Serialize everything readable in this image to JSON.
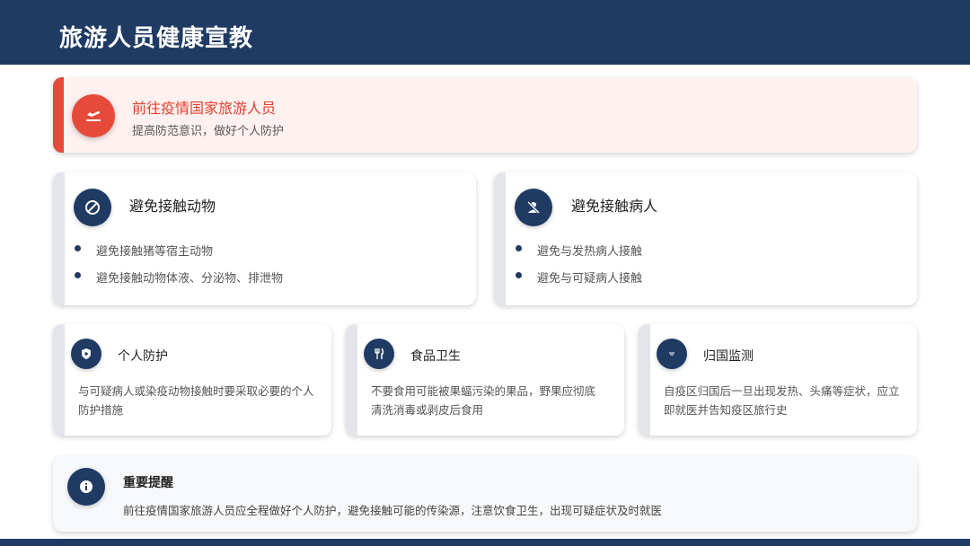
{
  "header": {
    "title": "旅游人员健康宣教"
  },
  "banner": {
    "icon": "airplane-departure-icon",
    "title": "前往疫情国家旅游人员",
    "subtitle": "提高防范意识，做好个人防护"
  },
  "cards_top": [
    {
      "icon": "prohibited-icon",
      "title": "避免接触动物",
      "items": [
        "避免接触猪等宿主动物",
        "避免接触动物体液、分泌物、排泄物"
      ]
    },
    {
      "icon": "no-person-icon",
      "title": "避免接触病人",
      "items": [
        "避免与发热病人接触",
        "避免与可疑病人接触"
      ]
    }
  ],
  "cards_mid": [
    {
      "icon": "shield-icon",
      "title": "个人防护",
      "text": "与可疑病人或染疫动物接触时要采取必要的个人防护措施"
    },
    {
      "icon": "utensils-icon",
      "title": "食品卫生",
      "text": "不要食用可能被果蝠污染的果品，野果应彻底清洗消毒或剥皮后食用"
    },
    {
      "icon": "thermometer-icon",
      "title": "归国监测",
      "text": "自疫区归国后一旦出现发热、头痛等症状，应立即就医并告知疫区旅行史"
    }
  ],
  "notice": {
    "icon": "info-icon",
    "title": "重要提醒",
    "text": "前往疫情国家旅游人员应全程做好个人防护，避免接触可能的传染源，注意饮食卫生，出现可疑症状及时就医"
  },
  "colors": {
    "navy": "#1f3a63",
    "red": "#e64a3b",
    "banner_bg": "#fff1f0"
  }
}
